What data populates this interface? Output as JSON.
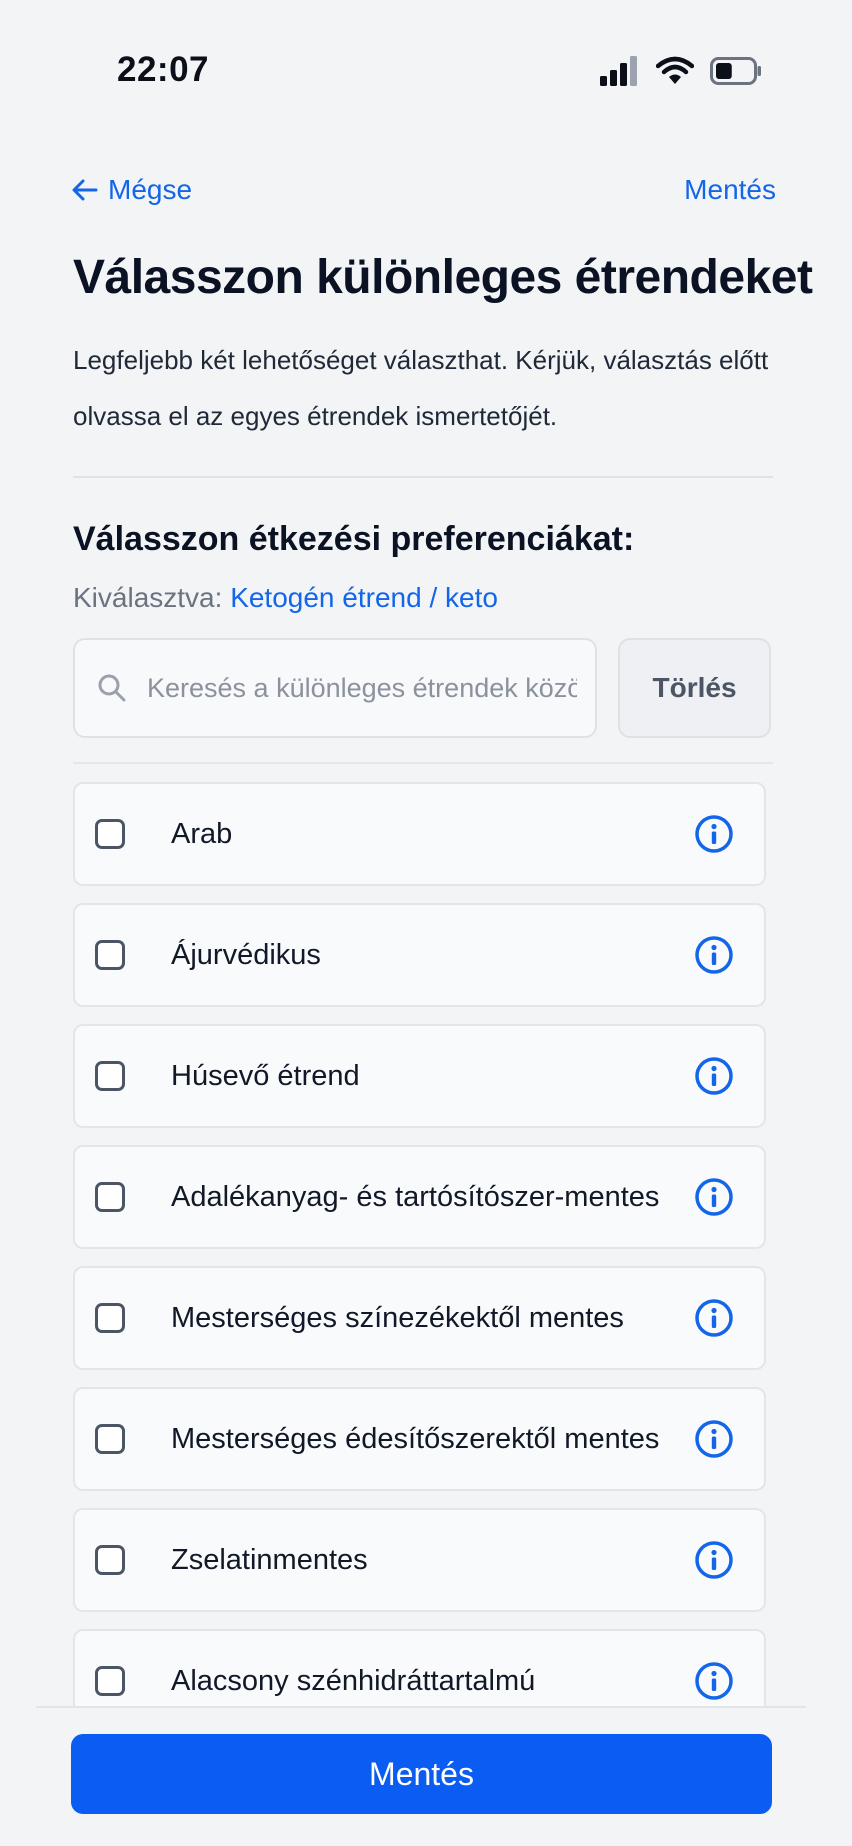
{
  "status_bar": {
    "time": "22:07",
    "icons": [
      "signal-icon",
      "wifi-icon",
      "battery-icon"
    ],
    "battery_level": 0.45
  },
  "nav": {
    "back_label": "Mégse",
    "save_label": "Mentés"
  },
  "header": {
    "title": "Válasszon különleges étrendeket",
    "description": "Legfeljebb két lehetőséget választhat. Kérjük, választás előtt olvassa el az egyes étrendek ismertetőjét."
  },
  "section": {
    "title": "Válasszon étkezési preferenciákat:",
    "selected_label": "Kiválasztva:",
    "selected_value": "Ketogén étrend / keto"
  },
  "search": {
    "value": "",
    "placeholder": "Keresés a különleges étrendek között",
    "clear_label": "Törlés"
  },
  "diets": [
    {
      "label": "Arab",
      "checked": false
    },
    {
      "label": "Ájurvédikus",
      "checked": false
    },
    {
      "label": "Húsevő étrend",
      "checked": false
    },
    {
      "label": "Adalékanyag- és tartósítószer-mentes",
      "checked": false
    },
    {
      "label": "Mesterséges színezékektől mentes",
      "checked": false
    },
    {
      "label": "Mesterséges édesítőszerektől mentes",
      "checked": false
    },
    {
      "label": "Zselatinmentes",
      "checked": false
    },
    {
      "label": "Alacsony szénhidráttartalmú",
      "checked": false
    }
  ],
  "footer": {
    "save_button_label": "Mentés"
  },
  "colors": {
    "accent": "#1366e8",
    "primary_button": "#0b5cf2",
    "background": "#f3f4f6"
  }
}
